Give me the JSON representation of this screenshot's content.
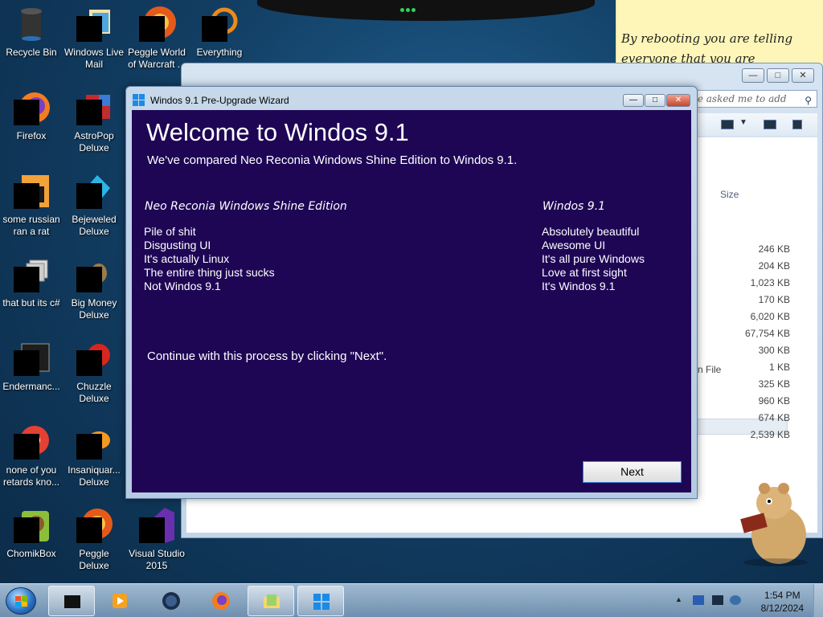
{
  "desktop": {
    "icons": [
      {
        "label": "Recycle Bin"
      },
      {
        "label": "Windows Live Mail"
      },
      {
        "label": "Peggle World of Warcraft ..."
      },
      {
        "label": "Everything"
      },
      {
        "label": "Firefox"
      },
      {
        "label": "AstroPop Deluxe"
      },
      {
        "label": "some russian ran a rat"
      },
      {
        "label": "Bejeweled Deluxe"
      },
      {
        "label": "that but its c#"
      },
      {
        "label": "Big Money Deluxe"
      },
      {
        "label": "Endermanc..."
      },
      {
        "label": "Chuzzle Deluxe"
      },
      {
        "label": "none of you retards kno..."
      },
      {
        "label": "Insaniquar... Deluxe"
      },
      {
        "label": "ChomikBox"
      },
      {
        "label": "Peggle Deluxe"
      },
      {
        "label": "Visual Studio 2015"
      }
    ]
  },
  "sticky_note": {
    "line1": "By rebooting you are telling",
    "line2": "everyone that you are"
  },
  "explorer": {
    "search_placeholder": "le asked me to add",
    "size_header": "Size",
    "type_partial": "n File",
    "sizes": [
      "246 KB",
      "204 KB",
      "1,023 KB",
      "170 KB",
      "6,020 KB",
      "67,754 KB",
      "300 KB",
      "1 KB",
      "325 KB",
      "960 KB",
      "674 KB",
      "2,539 KB"
    ]
  },
  "wizard": {
    "window_title": "Windos 9.1 Pre-Upgrade Wizard",
    "heading": "Welcome to Windos 9.1",
    "intro": "We've compared Neo Reconia Windows Shine Edition  to Windos 9.1.",
    "left_column": {
      "header": "Neo Reconia Windows Shine Edition",
      "items": [
        "Pile of shit",
        "Disgusting UI",
        "It's actually Linux",
        "The entire thing just sucks",
        "Not Windos 9.1"
      ]
    },
    "right_column": {
      "header": "Windos 9.1",
      "items": [
        "Absolutely beautiful",
        "Awesome UI",
        "It's all pure Windows",
        "Love at first sight",
        "It's Windos 9.1"
      ]
    },
    "continue_text": "Continue with this process by clicking \"Next\".",
    "next_label": "Next",
    "colors": {
      "panel_bg": "#1e0655",
      "text": "#ffffff"
    }
  },
  "taskbar": {
    "clock_time": "1:54 PM",
    "clock_date": "8/12/2024"
  }
}
